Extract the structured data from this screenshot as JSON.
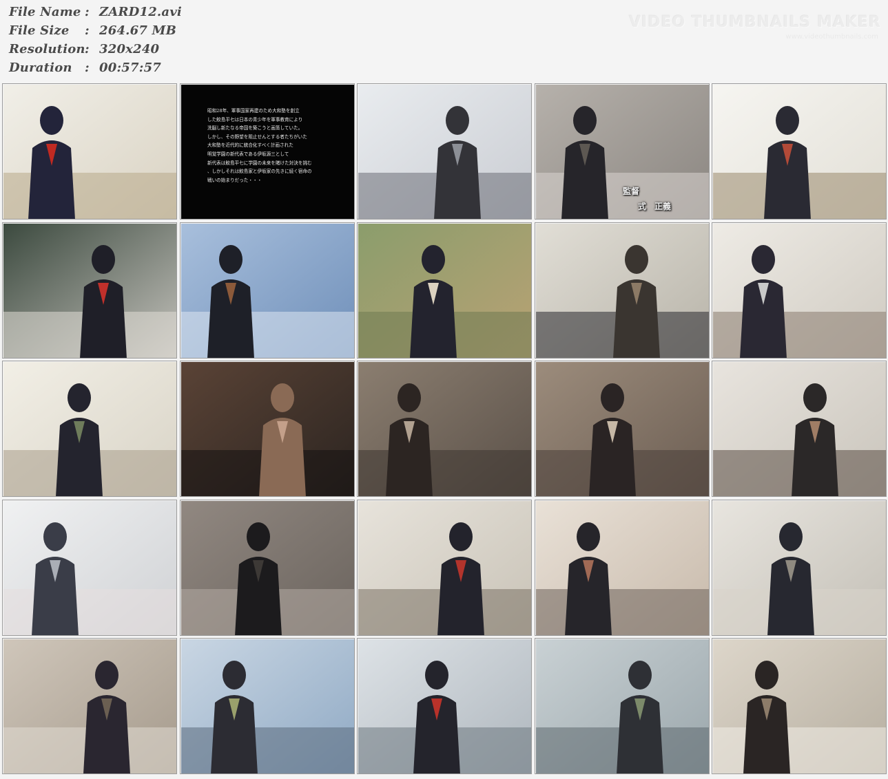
{
  "file_info": [
    {
      "key": "File Name",
      "sep": ":",
      "value": "ZARD12.avi"
    },
    {
      "key": "File Size",
      "sep": ":",
      "value": "264.67 MB"
    },
    {
      "key": "Resolution",
      "sep": ":",
      "value": "320x240"
    },
    {
      "key": "Duration",
      "sep": ":",
      "value": "00:57:57"
    }
  ],
  "watermark": {
    "title": "VIDEO THUMBNAILS MAKER",
    "subtitle": "www.videothumbnails.com"
  },
  "grid": {
    "columns": 5,
    "rows": 5
  },
  "thumbnails": [
    {
      "scene": "hallway-girl-sailor-uniform",
      "colors": [
        "#d9d2c2",
        "#f1efe8",
        "#23243a",
        "#c02a22",
        "#b8a98a"
      ]
    },
    {
      "scene": "black-intro-text",
      "colors": [
        "#050505",
        "#060606",
        "#0a0a0a",
        "#dcdcdc",
        "#101010"
      ],
      "text": "昭和28年、軍事国家再建のため大和塾を創立\nした鮫島平七は日本の青少年を軍事教育により\n洗脳し新たなる帝国を築こうと画策していた。\nしかし、その野望を阻止せんとする者たちがいた\n大和塾を近代的に統合化すべく計画された\n明覚学園の新代表である伊坂源三として\n新代表は鮫島平七に学園の未来を賭けた対決を挑む\n、しかしそれは鮫島家と伊坂家の先きに続く宿命の\n戦いの始まりだった・・・"
    },
    {
      "scene": "man-with-katana-rooftop",
      "colors": [
        "#c9ccd2",
        "#e9ecef",
        "#333338",
        "#8c8f96",
        "#6d7078"
      ]
    },
    {
      "scene": "girl-grey-textured-credit",
      "colors": [
        "#8a8580",
        "#b6b1ab",
        "#26252a",
        "#5d5852",
        "#d8d4cf"
      ],
      "credit": {
        "label": "監督",
        "name": "式　正義"
      }
    },
    {
      "scene": "classroom-window-fight",
      "colors": [
        "#e2dfd6",
        "#f6f5f1",
        "#2a2a33",
        "#b24a38",
        "#9b8a6e"
      ]
    },
    {
      "scene": "classroom-boxing-glove",
      "colors": [
        "#c4c2bc",
        "#3c4a3f",
        "#1f1f28",
        "#c0302b",
        "#e0ddd6"
      ]
    },
    {
      "scene": "students-sitting-sky",
      "colors": [
        "#6f8fb9",
        "#a8bfdc",
        "#1e2028",
        "#8c5a3a",
        "#dde6f0"
      ]
    },
    {
      "scene": "girl-katana-classroom",
      "colors": [
        "#b9a274",
        "#8b9d6c",
        "#23232e",
        "#dcd2c0",
        "#6f7a52"
      ]
    },
    {
      "scene": "hallway-man-glasses",
      "colors": [
        "#b7b3a8",
        "#e1ded6",
        "#3a3530",
        "#8c7a65",
        "#2a2a30"
      ]
    },
    {
      "scene": "office-fight-headband",
      "colors": [
        "#cfcac1",
        "#eeebe5",
        "#2a2833",
        "#c9c9c9",
        "#8a7c70"
      ]
    },
    {
      "scene": "office-girl-boxing",
      "colors": [
        "#d8d3c6",
        "#f2efe6",
        "#24242e",
        "#6e7c5b",
        "#a99f8c"
      ]
    },
    {
      "scene": "closeup-girl-face",
      "colors": [
        "#2b2420",
        "#5a4336",
        "#8a6a55",
        "#c4a08a",
        "#151313"
      ]
    },
    {
      "scene": "camo-figure-hanging",
      "colors": [
        "#5a5048",
        "#8b7e70",
        "#2c2522",
        "#b1a190",
        "#3e3631"
      ]
    },
    {
      "scene": "camo-room-girl",
      "colors": [
        "#6b5d52",
        "#9c8c7c",
        "#2a2424",
        "#c6b8a6",
        "#4b403a"
      ]
    },
    {
      "scene": "man-white-hair-headband",
      "colors": [
        "#c9c4bb",
        "#e8e4de",
        "#2b2828",
        "#a07d65",
        "#5b4e46"
      ]
    },
    {
      "scene": "man-arms-crossed-blur",
      "colors": [
        "#cfd1d4",
        "#f0f1f2",
        "#3a3d48",
        "#aaaeb6",
        "#e6dede"
      ]
    },
    {
      "scene": "closeup-shoes-floor",
      "colors": [
        "#6a635d",
        "#918881",
        "#1c1b1d",
        "#3d3936",
        "#b3aaa3"
      ]
    },
    {
      "scene": "office-girls-ninjas",
      "colors": [
        "#c8c2b6",
        "#e7e3db",
        "#23232c",
        "#b3342c",
        "#7d7468"
      ]
    },
    {
      "scene": "struggle-leather-jacket",
      "colors": [
        "#c7b9aa",
        "#e9e1d7",
        "#26252a",
        "#a16a55",
        "#6f655d"
      ]
    },
    {
      "scene": "stairwell-fight",
      "colors": [
        "#c3bfb6",
        "#e8e5df",
        "#272830",
        "#8f8a80",
        "#d9d4cb"
      ]
    },
    {
      "scene": "girl-behind-shoulder",
      "colors": [
        "#a59a8c",
        "#cfc6ba",
        "#2a2630",
        "#6b5f52",
        "#e0dad2"
      ]
    },
    {
      "scene": "rooftop-man-girl-katana",
      "colors": [
        "#8fa9c4",
        "#c9d6e3",
        "#2c2c33",
        "#9aa06c",
        "#5b6c7d"
      ]
    },
    {
      "scene": "girl-rooftop-fence",
      "colors": [
        "#aeb6bd",
        "#dde2e6",
        "#24242c",
        "#b8322a",
        "#6f7a82"
      ]
    },
    {
      "scene": "rooftop-man-punch",
      "colors": [
        "#9aa6ab",
        "#c9d1d4",
        "#2e3035",
        "#7c8a6a",
        "#5e6a70"
      ]
    },
    {
      "scene": "girl-smiling-window",
      "colors": [
        "#b6aea0",
        "#ddd6ca",
        "#2a2524",
        "#8d7c69",
        "#f1ede6"
      ]
    }
  ]
}
